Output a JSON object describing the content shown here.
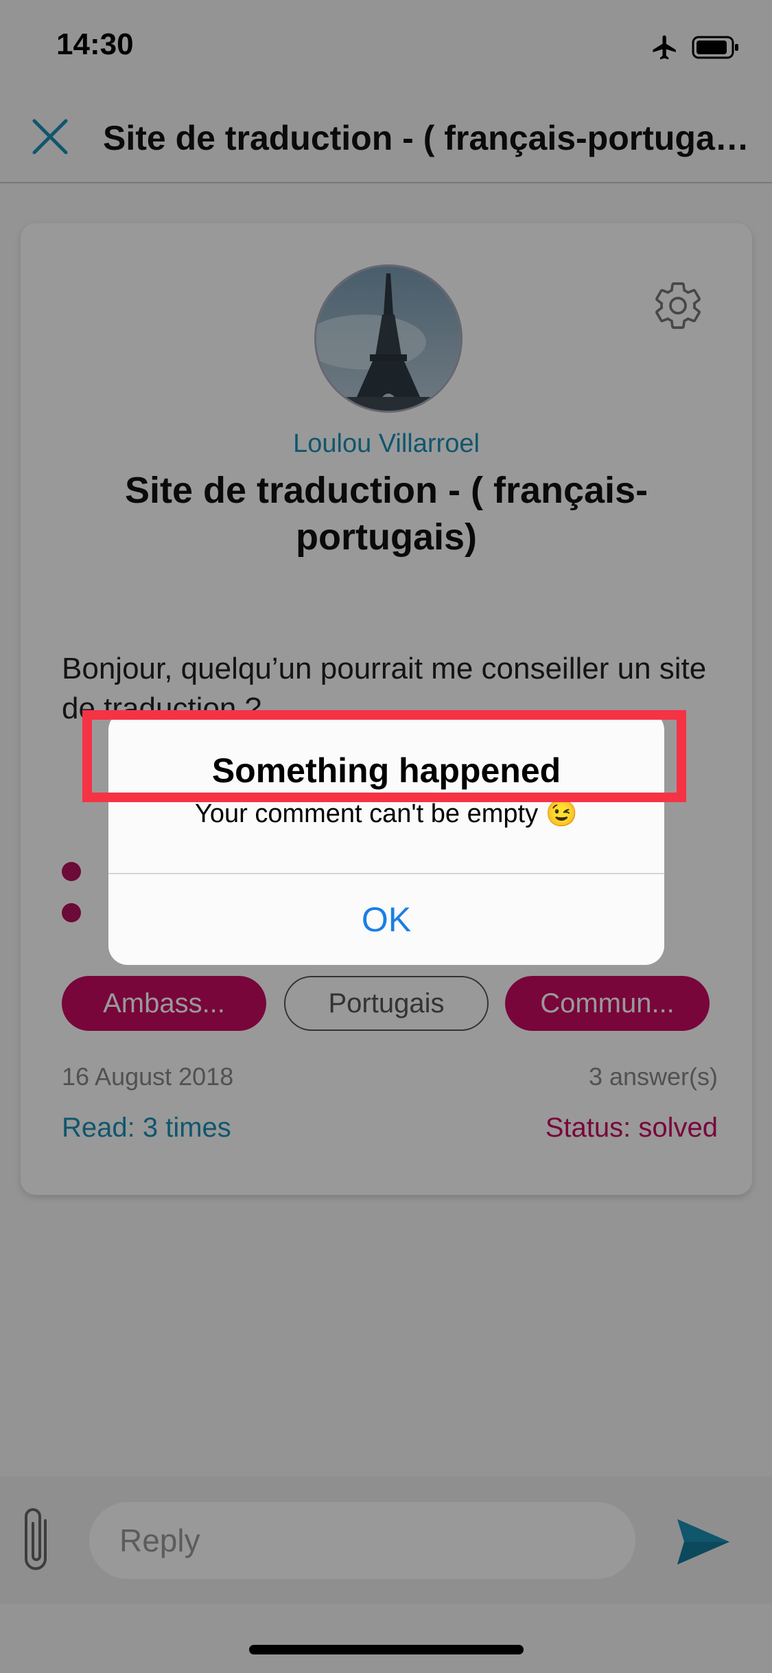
{
  "status_bar": {
    "time": "14:30"
  },
  "header": {
    "title": "Site de traduction  - ( français-portugais)"
  },
  "post": {
    "author": "Loulou Villarroel",
    "title": "Site de traduction  - ( français-portugais)",
    "body": "Bonjour, quelqu’un pourrait me conseiller un site de traduction ?",
    "tags": [
      "Ambass...",
      "Portugais",
      "Commun..."
    ],
    "date": "16 August 2018",
    "answers": "3 answer(s)",
    "read": "Read: 3 times",
    "status": "Status: solved"
  },
  "reply": {
    "placeholder": "Reply"
  },
  "alert": {
    "title": "Something happened",
    "message": "Your comment can't be empty 😉",
    "ok_label": "OK"
  },
  "colors": {
    "accent_blue": "#1b8fb6",
    "accent_magenta": "#c90a62",
    "highlight_red": "#f53345",
    "alert_button": "#1a7ee6"
  },
  "icons": [
    "close-icon",
    "gear-icon",
    "airplane-icon",
    "battery-icon",
    "paperclip-icon",
    "send-icon"
  ]
}
